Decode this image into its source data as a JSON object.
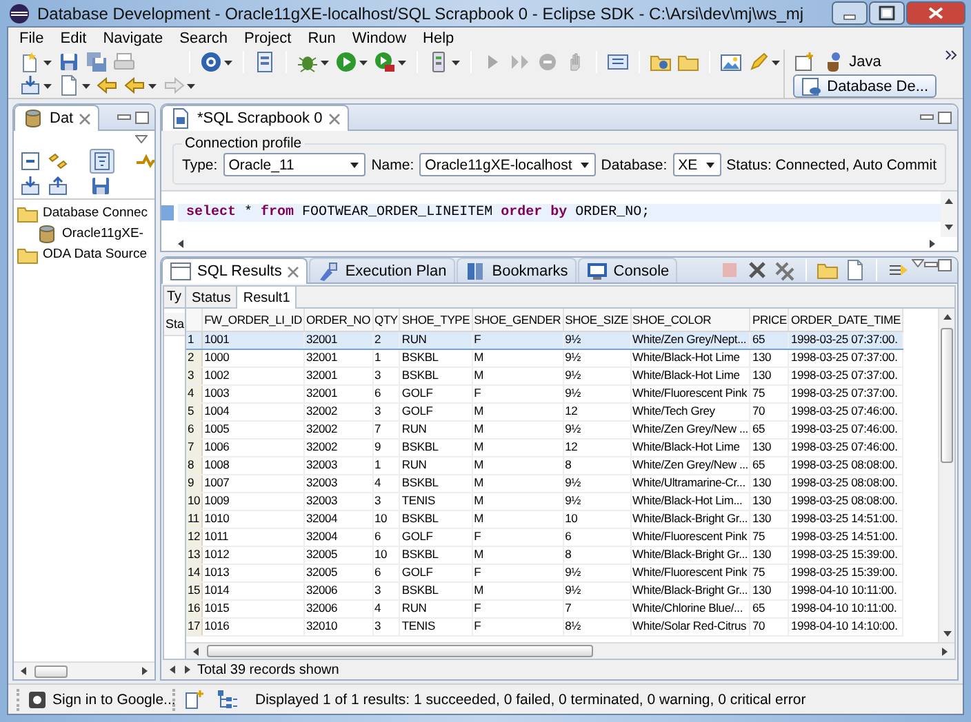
{
  "window": {
    "title": "Database Development - Oracle11gXE-localhost/SQL Scrapbook 0 - Eclipse SDK - C:\\Arsi\\dev\\mj\\ws_mj"
  },
  "menu": [
    "File",
    "Edit",
    "Navigate",
    "Search",
    "Project",
    "Run",
    "Window",
    "Help"
  ],
  "perspectives": [
    {
      "label": "Java",
      "selected": false
    },
    {
      "label": "Database De...",
      "selected": true
    }
  ],
  "navigator": {
    "tab": "Dat",
    "tree": [
      {
        "label": "Database Connec",
        "kind": "folder",
        "children": [
          {
            "label": "Oracle11gXE-",
            "kind": "connection"
          }
        ]
      },
      {
        "label": "ODA Data Source",
        "kind": "folder"
      }
    ]
  },
  "editor": {
    "tab": "*SQL Scrapbook 0",
    "connection_profile": {
      "title": "Connection profile",
      "type_label": "Type:",
      "type": "Oracle_11",
      "name_label": "Name:",
      "name": "Oracle11gXE-localhost",
      "database_label": "Database:",
      "database": "XE",
      "status": "Status: Connected, Auto Commit"
    },
    "sql": "**select** * **from** FOOTWEAR_ORDER_LINEITEM **order by** ORDER_NO;"
  },
  "results": {
    "tabs": [
      {
        "label": "SQL Results",
        "selected": true
      },
      {
        "label": "Execution Plan",
        "selected": false
      },
      {
        "label": "Bookmarks",
        "selected": false
      },
      {
        "label": "Console",
        "selected": false
      }
    ],
    "history": {
      "tab": "Ty",
      "column": "Sta"
    },
    "result_tabs": [
      {
        "label": "Status",
        "selected": false
      },
      {
        "label": "Result1",
        "selected": true
      }
    ],
    "table": {
      "columns": [
        "FW_ORDER_LI_ID",
        "ORDER_NO",
        "QTY",
        "SHOE_TYPE",
        "SHOE_GENDER",
        "SHOE_SIZE",
        "SHOE_COLOR",
        "PRICE",
        "ORDER_DATE_TIME"
      ],
      "rows": [
        {
          "number": "1",
          "selected": true,
          "cells": [
            "1001",
            "32001",
            "2",
            "RUN",
            "F",
            "9½",
            "White/Zen Grey/Nept...",
            "65",
            "1998-03-25 07:37:00."
          ]
        },
        {
          "number": "2",
          "selected": false,
          "cells": [
            "1000",
            "32001",
            "1",
            "BSKBL",
            "M",
            "9½",
            "White/Black-Hot Lime",
            "130",
            "1998-03-25 07:37:00."
          ]
        },
        {
          "number": "3",
          "selected": false,
          "cells": [
            "1002",
            "32001",
            "3",
            "BSKBL",
            "M",
            "9½",
            "White/Black-Hot Lime",
            "130",
            "1998-03-25 07:37:00."
          ]
        },
        {
          "number": "4",
          "selected": false,
          "cells": [
            "1003",
            "32001",
            "6",
            "GOLF",
            "F",
            "9½",
            "White/Fluorescent Pink",
            "75",
            "1998-03-25 07:37:00."
          ]
        },
        {
          "number": "5",
          "selected": false,
          "cells": [
            "1004",
            "32002",
            "3",
            "GOLF",
            "M",
            "12",
            "White/Tech Grey",
            "70",
            "1998-03-25 07:46:00."
          ]
        },
        {
          "number": "6",
          "selected": false,
          "cells": [
            "1005",
            "32002",
            "7",
            "RUN",
            "M",
            "9½",
            "White/Zen Grey/New ...",
            "65",
            "1998-03-25 07:46:00."
          ]
        },
        {
          "number": "7",
          "selected": false,
          "cells": [
            "1006",
            "32002",
            "9",
            "BSKBL",
            "M",
            "12",
            "White/Black-Hot Lime",
            "130",
            "1998-03-25 07:46:00."
          ]
        },
        {
          "number": "8",
          "selected": false,
          "cells": [
            "1008",
            "32003",
            "1",
            "RUN",
            "M",
            "8",
            "White/Zen Grey/New ...",
            "65",
            "1998-03-25 08:08:00."
          ]
        },
        {
          "number": "9",
          "selected": false,
          "cells": [
            "1007",
            "32003",
            "4",
            "BSKBL",
            "M",
            "9½",
            "White/Ultramarine-Cr...",
            "130",
            "1998-03-25 08:08:00."
          ]
        },
        {
          "number": "10",
          "selected": false,
          "cells": [
            "1009",
            "32003",
            "3",
            "TENIS",
            "M",
            "9½",
            "White/Black-Hot Lim...",
            "130",
            "1998-03-25 08:08:00."
          ]
        },
        {
          "number": "11",
          "selected": false,
          "cells": [
            "1010",
            "32004",
            "10",
            "BSKBL",
            "M",
            "10",
            "White/Black-Bright Gr...",
            "130",
            "1998-03-25 14:51:00."
          ]
        },
        {
          "number": "12",
          "selected": false,
          "cells": [
            "1011",
            "32004",
            "6",
            "GOLF",
            "F",
            "6",
            "White/Fluorescent Pink",
            "75",
            "1998-03-25 14:51:00."
          ]
        },
        {
          "number": "13",
          "selected": false,
          "cells": [
            "1012",
            "32005",
            "10",
            "BSKBL",
            "M",
            "8",
            "White/Black-Bright Gr...",
            "130",
            "1998-03-25 15:39:00."
          ]
        },
        {
          "number": "14",
          "selected": false,
          "cells": [
            "1013",
            "32005",
            "6",
            "GOLF",
            "F",
            "9½",
            "White/Fluorescent Pink",
            "75",
            "1998-03-25 15:39:00."
          ]
        },
        {
          "number": "15",
          "selected": false,
          "cells": [
            "1014",
            "32006",
            "3",
            "BSKBL",
            "M",
            "9½",
            "White/Black-Bright Gr...",
            "130",
            "1998-04-10 10:11:00."
          ]
        },
        {
          "number": "16",
          "selected": false,
          "cells": [
            "1015",
            "32006",
            "4",
            "RUN",
            "F",
            "7",
            "White/Chlorine Blue/...",
            "65",
            "1998-04-10 10:11:00."
          ]
        },
        {
          "number": "17",
          "selected": false,
          "cells": [
            "1016",
            "32010",
            "3",
            "TENIS",
            "F",
            "8½",
            "White/Solar Red-Citrus",
            "70",
            "1998-04-10 14:10:00."
          ]
        }
      ]
    },
    "footer": "Total 39 records shown"
  },
  "status_bar": {
    "sign_in": "Sign in to Google...",
    "message": "Displayed 1 of 1 results: 1 succeeded, 0 failed, 0 terminated, 0 warning, 0 critical error"
  }
}
